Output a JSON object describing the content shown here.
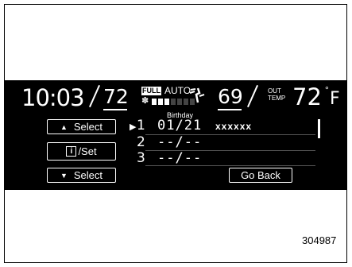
{
  "status": {
    "time": "10:03",
    "left_temp": "72",
    "fan_mode_badge": "FULL",
    "climate_mode": "AUTO",
    "fan_level": 3,
    "fan_level_max": 7,
    "right_temp": "69",
    "out_temp_label_1": "OUT",
    "out_temp_label_2": "TEMP",
    "out_temp_value": "72",
    "out_temp_unit": "F",
    "degree_symbol": "°"
  },
  "buttons": {
    "select_up": "Select",
    "info_set": "/Set",
    "info_icon": "i",
    "select_down": "Select",
    "go_back": "Go Back"
  },
  "list": {
    "title": "Birthday",
    "selected_marker": "▶",
    "rows": [
      {
        "num": "1",
        "date": "01/21",
        "name": "xxxxxx"
      },
      {
        "num": "2",
        "date": "--/--",
        "name": ""
      },
      {
        "num": "3",
        "date": "--/--",
        "name": ""
      }
    ]
  },
  "figure_code": "304987",
  "icons": {
    "up": "up-triangle-icon",
    "down": "down-triangle-icon",
    "info": "info-icon",
    "fan": "fan-icon",
    "airflow": "airflow-icon"
  }
}
